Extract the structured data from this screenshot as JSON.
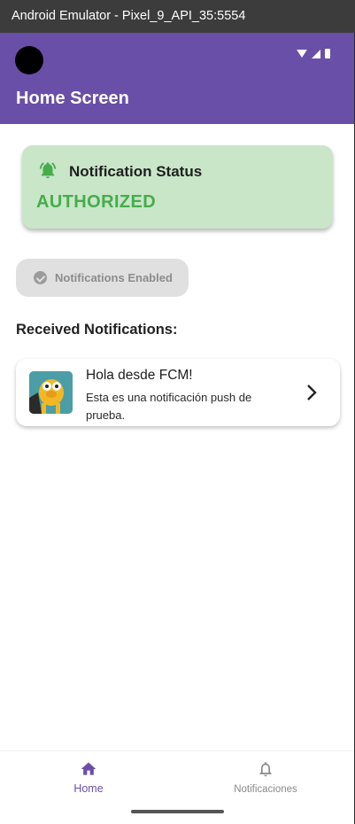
{
  "window": {
    "title": "Android Emulator - Pixel_9_API_35:5554"
  },
  "appbar": {
    "title": "Home Screen"
  },
  "status_card": {
    "title": "Notification Status",
    "value": "AUTHORIZED",
    "accent_color": "#46ad4b",
    "icon": "bell-ringing-icon"
  },
  "enabled_button": {
    "label": "Notifications Enabled",
    "icon": "check-circle-icon"
  },
  "received": {
    "title": "Received Notifications:",
    "items": [
      {
        "title": "Hola desde FCM!",
        "body": "Esta es una notificación push de prueba.",
        "icon": "jake-avatar-image"
      }
    ]
  },
  "bottom_nav": {
    "items": [
      {
        "label": "Home",
        "icon": "home-icon",
        "active": true
      },
      {
        "label": "Notificaciones",
        "icon": "bell-icon",
        "active": false
      }
    ]
  },
  "colors": {
    "primary": "#6a4fa8",
    "status_bg": "#c9e6c9"
  }
}
